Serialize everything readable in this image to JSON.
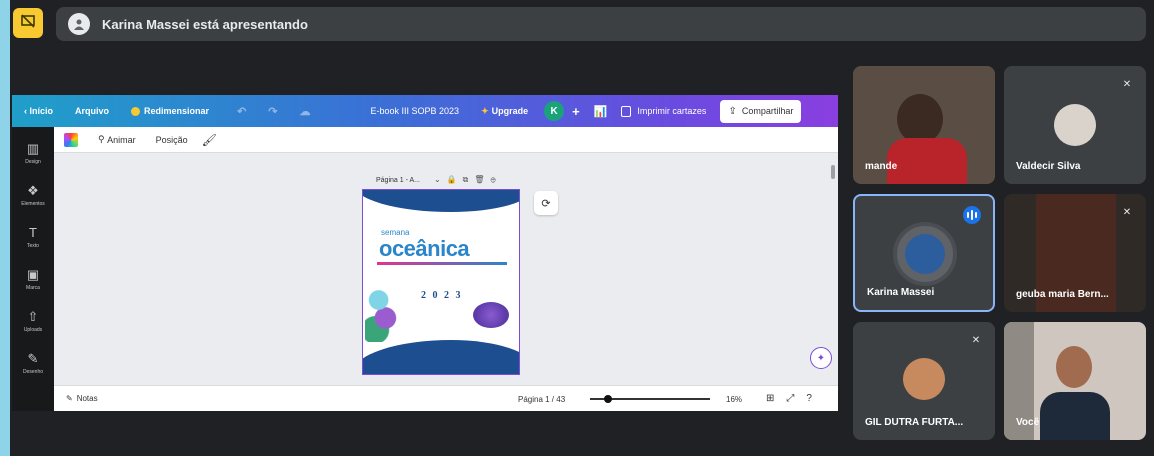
{
  "top": {
    "present_icon": "present-off-icon",
    "presenter_banner": "Karina Massei está apresentando"
  },
  "canva": {
    "back_label": "Início",
    "menu_file": "Arquivo",
    "resize_label": "Redimensionar",
    "doc_title": "E-book III SOPB 2023",
    "upgrade_label": "Upgrade",
    "avatar_initial": "K",
    "print_label": "Imprimir cartazes",
    "share_label": "Compartilhar",
    "toolbar": {
      "animate_label": "Animar",
      "position_label": "Posição"
    },
    "sidebar": [
      {
        "icon": "▥",
        "label": "Design"
      },
      {
        "icon": "❖",
        "label": "Elementos"
      },
      {
        "icon": "T",
        "label": "Texto"
      },
      {
        "icon": "▣",
        "label": "Marca"
      },
      {
        "icon": "⇧",
        "label": "Uploads"
      },
      {
        "icon": "✎",
        "label": "Desenho"
      }
    ],
    "page_label": "Página 1 - A...",
    "cover": {
      "semana": "semana",
      "oceanica": "oceânica",
      "year": "2 0 2 3"
    },
    "bottom": {
      "notes_label": "Notas",
      "page_indicator": "Página 1 / 43",
      "zoom": "16%"
    }
  },
  "participants": [
    {
      "name": "mande",
      "muted": false
    },
    {
      "name": "Valdecir Silva",
      "muted": true
    },
    {
      "name": "Karina Massei",
      "muted": false,
      "speaking": true
    },
    {
      "name": "geuba maria Bern...",
      "muted": true
    },
    {
      "name": "GIL DUTRA FURTA...",
      "muted": true
    },
    {
      "name": "Você",
      "muted": false
    }
  ],
  "colors": {
    "meet_bg": "#202124",
    "tile_bg": "#3c4043",
    "present_accent": "#f9c932",
    "active_border": "#8ab4f8",
    "canva_purple": "#7d4bd8"
  }
}
